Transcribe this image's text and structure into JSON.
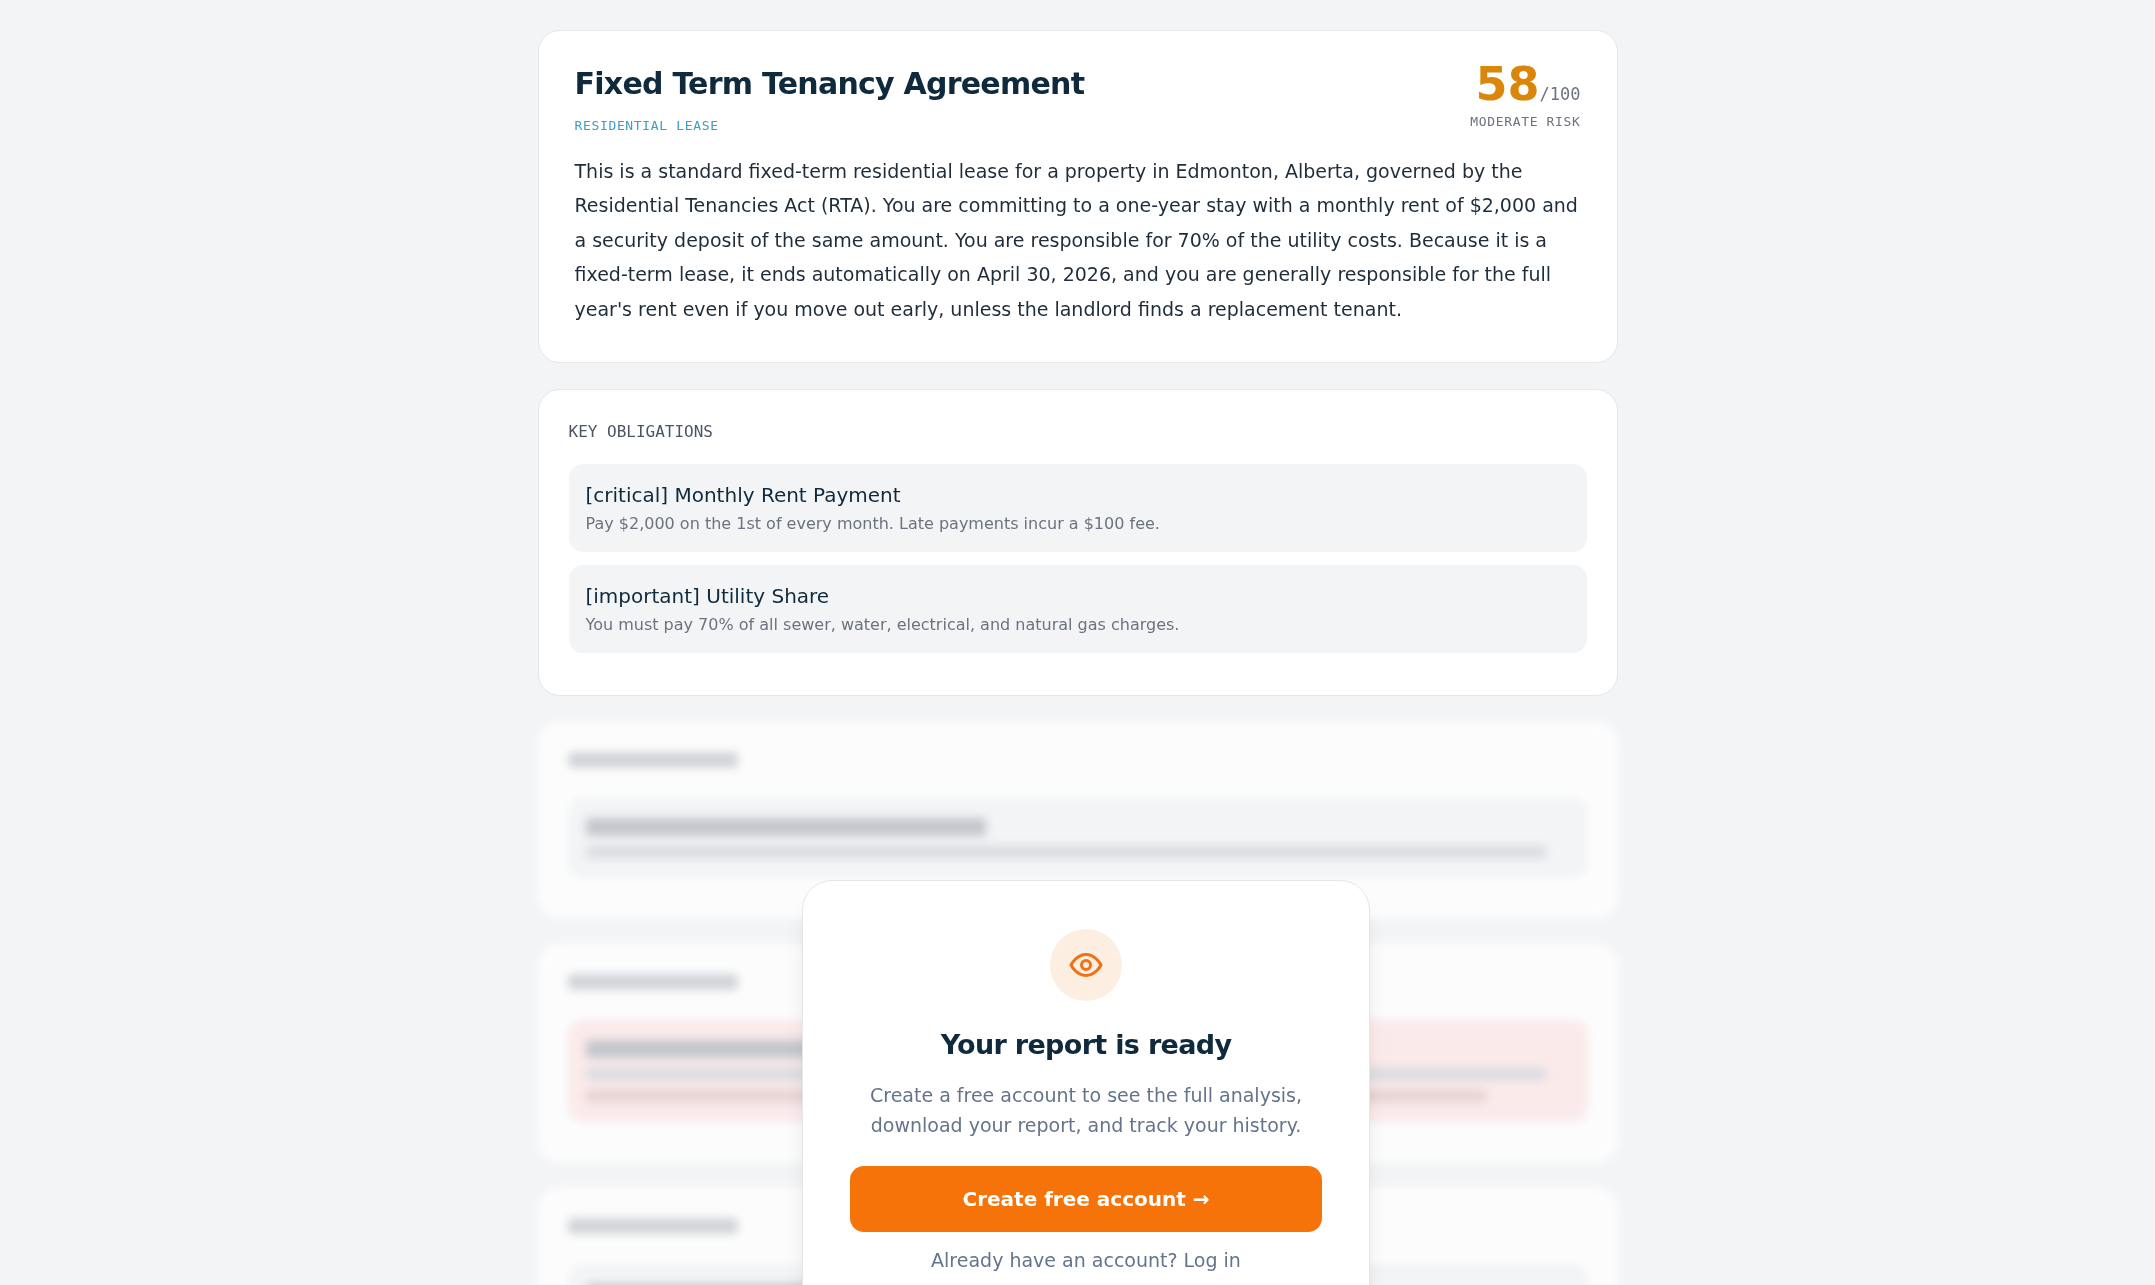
{
  "summary": {
    "title": "Fixed Term Tenancy Agreement",
    "category": "RESIDENTIAL LEASE",
    "score": "58",
    "score_max": "/100",
    "risk_label": "MODERATE RISK",
    "description": "This is a standard fixed-term residential lease for a property in Edmonton, Alberta, governed by the Residential Tenancies Act (RTA). You are committing to a one-year stay with a monthly rent of $2,000 and a security deposit of the same amount. You are responsible for 70% of the utility costs. Because it is a fixed-term lease, it ends automatically on April 30, 2026, and you are generally responsible for the full year's rent even if you move out early, unless the landlord finds a replacement tenant."
  },
  "obligations": {
    "heading": "KEY OBLIGATIONS",
    "items": [
      {
        "title": "[critical] Monthly Rent Payment",
        "detail": "Pay $2,000 on the 1st of every month. Late payments incur a $100 fee."
      },
      {
        "title": "[important] Utility Share",
        "detail": "You must pay 70% of all sewer, water, electrical, and natural gas charges."
      }
    ]
  },
  "locked_sections": [
    {
      "kind": "neutral"
    },
    {
      "kind": "alert"
    },
    {
      "kind": "neutral"
    }
  ],
  "gate": {
    "title": "Your report is ready",
    "message": "Create a free account to see the full analysis, download your report, and track your history.",
    "button": "Create free account →",
    "login": "Already have an account? Log in"
  }
}
